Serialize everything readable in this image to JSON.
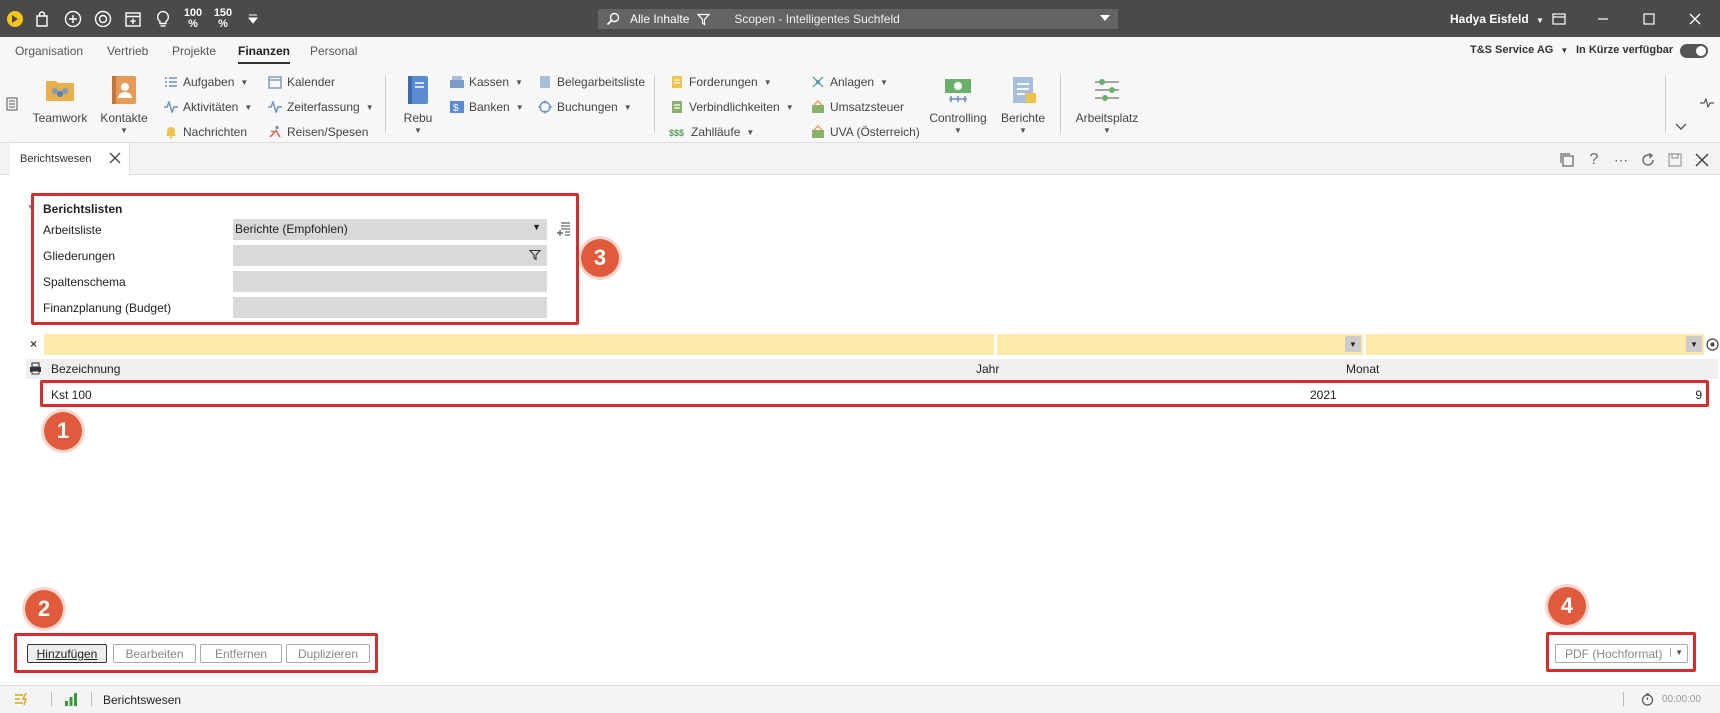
{
  "titlebar": {
    "zoom1": "100\n%",
    "zoom1_a": "100",
    "zoom1_b": "%",
    "zoom2_a": "150",
    "zoom2_b": "%",
    "search_scope": "Alle Inhalte",
    "search_placeholder": "Scopen - Intelligentes Suchfeld",
    "user": "Hadya Eisfeld"
  },
  "menu": {
    "tabs": [
      "Organisation",
      "Vertrieb",
      "Projekte",
      "Finanzen",
      "Personal"
    ],
    "active": "Finanzen",
    "company": "T&S Service AG",
    "soon": "In Kürze verfügbar"
  },
  "ribbon": {
    "teamwork": "Teamwork",
    "kontakte": "Kontakte",
    "aufgaben": "Aufgaben",
    "aktivitaeten": "Aktivitäten",
    "nachrichten": "Nachrichten",
    "kalender": "Kalender",
    "zeiterfassung": "Zeiterfassung",
    "reisen": "Reisen/Spesen",
    "rebu": "Rebu",
    "kassen": "Kassen",
    "banken": "Banken",
    "belegarbeitsliste": "Belegarbeitsliste",
    "buchungen": "Buchungen",
    "forderungen": "Forderungen",
    "verbindlichkeiten": "Verbindlichkeiten",
    "zahllaeufe": "Zahlläufe",
    "anlagen": "Anlagen",
    "umsatzsteuer": "Umsatzsteuer",
    "uva": "UVA (Österreich)",
    "controlling": "Controlling",
    "berichte": "Berichte",
    "arbeitsplatz": "Arbeitsplatz"
  },
  "doctab": {
    "title": "Berichtswesen"
  },
  "form": {
    "section_title": "Berichtslisten",
    "arbeitsliste_label": "Arbeitsliste",
    "arbeitsliste_value": "Berichte (Empfohlen)",
    "gliederungen_label": "Gliederungen",
    "gliederungen_value": "",
    "spaltenschema_label": "Spaltenschema",
    "spaltenschema_value": "",
    "finanzplanung_label": "Finanzplanung (Budget)",
    "finanzplanung_value": ""
  },
  "table": {
    "columns": [
      "Bezeichnung",
      "Jahr",
      "Monat"
    ],
    "rows": [
      {
        "bezeichnung": "Kst 100",
        "jahr": "2021",
        "monat": "9"
      }
    ]
  },
  "footer": {
    "buttons": [
      "Hinzufügen",
      "Bearbeiten",
      "Entfernen",
      "Duplizieren"
    ],
    "export_value": "PDF (Hochformat)"
  },
  "callouts": [
    "1",
    "2",
    "3",
    "4"
  ],
  "statusbar": {
    "module": "Berichtswesen",
    "timer": "00:00:00"
  },
  "colors": {
    "accent_red": "#d32f2f",
    "callout": "#e05a3c",
    "titlebar": "#4a4a4a",
    "filter": "#fde9a9"
  }
}
